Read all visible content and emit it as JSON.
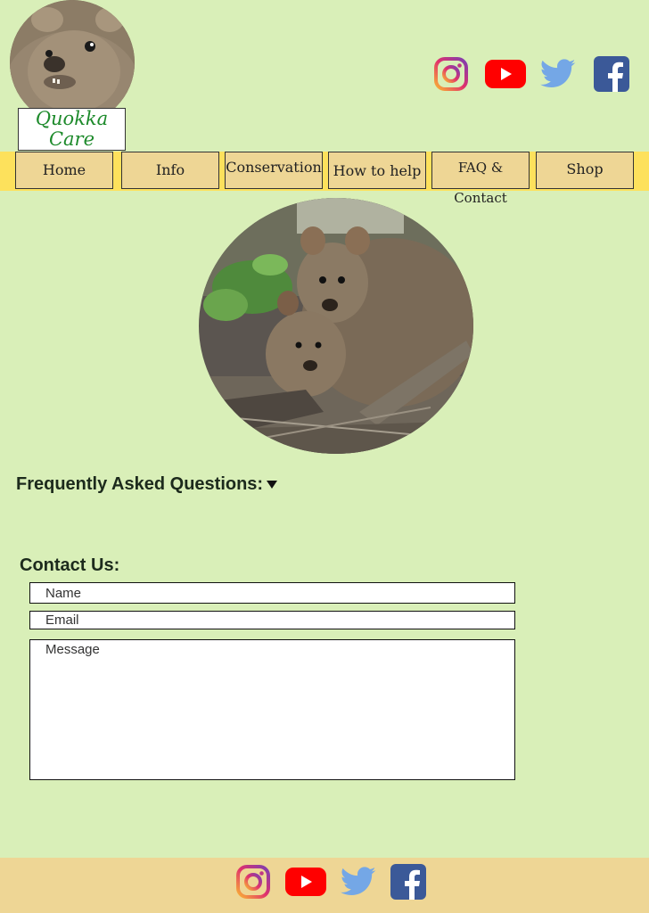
{
  "logo": {
    "line1": "Quokka",
    "line2": "Care"
  },
  "social": [
    {
      "name": "instagram-icon",
      "color": "#c13584"
    },
    {
      "name": "youtube-icon",
      "color": "#ff0000"
    },
    {
      "name": "twitter-icon",
      "color": "#74a7e6"
    },
    {
      "name": "facebook-icon",
      "color": "#3b5998"
    }
  ],
  "nav": {
    "items": [
      {
        "label": "Home"
      },
      {
        "label": "Info"
      },
      {
        "label": "Conservation"
      },
      {
        "label": "How to help"
      },
      {
        "label": "FAQ & Contact"
      },
      {
        "label": "Shop"
      }
    ]
  },
  "faq": {
    "title": "Frequently Asked Questions:"
  },
  "contact": {
    "title": "Contact Us:",
    "name_placeholder": "Name",
    "email_placeholder": "Email",
    "message_placeholder": "Message"
  },
  "colors": {
    "background": "#d9efb8",
    "nav_bar": "#fde15c",
    "nav_button": "#eed695",
    "footer": "#eed695",
    "logo_text": "#1d8a2b"
  }
}
